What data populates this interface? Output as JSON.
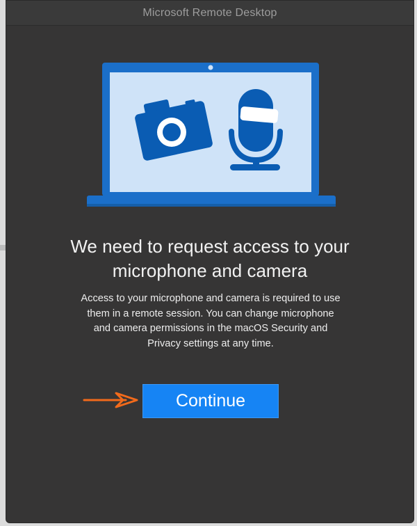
{
  "window": {
    "title": "Microsoft Remote Desktop"
  },
  "illustration": {
    "icons": [
      "laptop-icon",
      "camera-icon",
      "microphone-icon"
    ],
    "colors": {
      "laptop_frame": "#1b6fc9",
      "screen": "#cfe3f8",
      "icon_fill": "#0a5cb3"
    }
  },
  "content": {
    "heading_line1": "We need to request access to your",
    "heading_line2": "microphone and camera",
    "body_line1": "Access to your microphone and camera is required to use",
    "body_line2": "them in a remote session. You can change microphone",
    "body_line3": "and camera permissions in the macOS Security and",
    "body_line4": "Privacy settings at any time."
  },
  "actions": {
    "continue_label": "Continue"
  },
  "annotation": {
    "icon": "arrow-right-icon",
    "color": "#f26a1b"
  },
  "theme": {
    "accent": "#1684f4",
    "background": "#363535"
  }
}
